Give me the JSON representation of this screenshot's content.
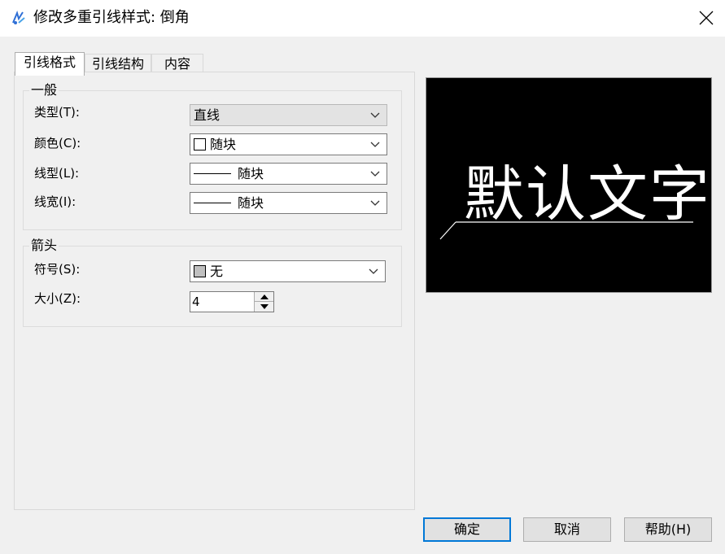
{
  "window": {
    "title": "修改多重引线样式: 倒角"
  },
  "tabs": [
    {
      "label": "引线格式",
      "active": true
    },
    {
      "label": "引线结构",
      "active": false
    },
    {
      "label": "内容",
      "active": false
    }
  ],
  "general": {
    "legend": "一般",
    "type_label": "类型(T):",
    "type_value": "直线",
    "color_label": "颜色(C):",
    "color_value": "随块",
    "linetype_label": "线型(L):",
    "linetype_value": "随块",
    "lineweight_label": "线宽(I):",
    "lineweight_value": "随块"
  },
  "arrowhead": {
    "legend": "箭头",
    "symbol_label": "符号(S):",
    "symbol_value": "无",
    "size_label": "大小(Z):",
    "size_value": "4"
  },
  "preview": {
    "text": "默认文字"
  },
  "buttons": {
    "ok": "确定",
    "cancel": "取消",
    "help": "帮助(H)"
  },
  "colors": {
    "accent": "#0078d7",
    "preview_bg": "#000000",
    "preview_fg": "#ffffff"
  }
}
